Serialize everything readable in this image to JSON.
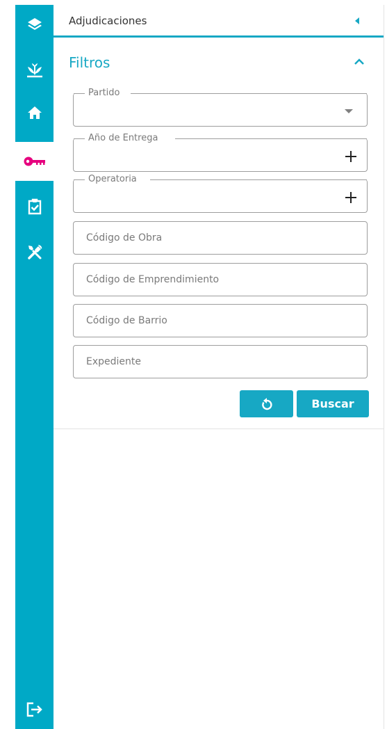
{
  "sidebar": {
    "items": [
      {
        "icon": "layers-icon",
        "active": false
      },
      {
        "icon": "sprout-icon",
        "active": false
      },
      {
        "icon": "home-icon",
        "active": false
      },
      {
        "icon": "key-icon",
        "active": true
      },
      {
        "icon": "clipboard-check-icon",
        "active": false
      },
      {
        "icon": "tools-icon",
        "active": false
      }
    ],
    "bottom_icon": "logout-icon",
    "color": "#00a9c6",
    "active_icon_color": "#e6007e"
  },
  "panel": {
    "title": "Adjudicaciones",
    "accent_color": "#17a8c4"
  },
  "filters": {
    "title": "Filtros",
    "fields": {
      "partido": {
        "label": "Partido",
        "value": ""
      },
      "anio_entrega": {
        "label": "Año de Entrega",
        "value": ""
      },
      "operatoria": {
        "label": "Operatoria",
        "value": ""
      },
      "codigo_obra": {
        "placeholder": "Código de Obra",
        "value": ""
      },
      "codigo_emprendimiento": {
        "placeholder": "Código de Emprendimiento",
        "value": ""
      },
      "codigo_barrio": {
        "placeholder": "Código de Barrio",
        "value": ""
      },
      "expediente": {
        "placeholder": "Expediente",
        "value": ""
      }
    },
    "reset_icon": "reset-icon",
    "search_label": "Buscar"
  }
}
